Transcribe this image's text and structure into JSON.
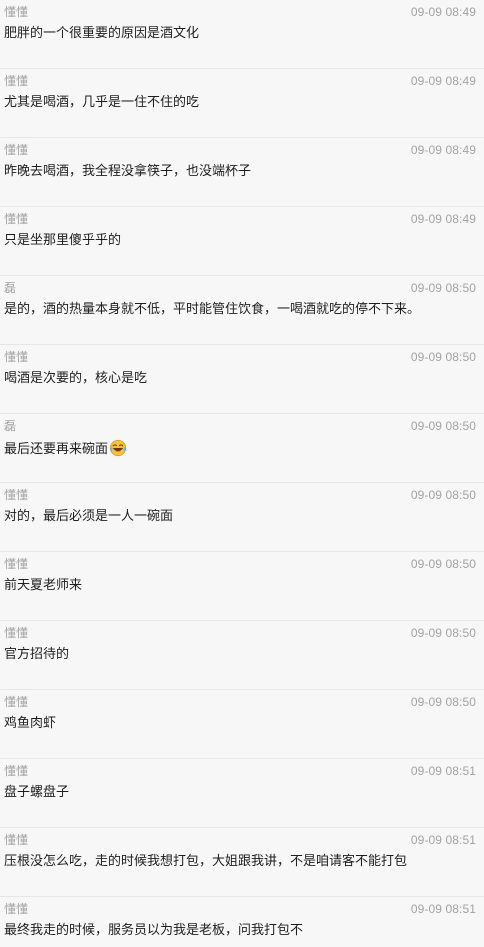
{
  "messages": [
    {
      "sender": "懂懂",
      "time": "09-09 08:49",
      "text": "肥胖的一个很重要的原因是酒文化"
    },
    {
      "sender": "懂懂",
      "time": "09-09 08:49",
      "text": "尤其是喝酒，几乎是一住不住的吃"
    },
    {
      "sender": "懂懂",
      "time": "09-09 08:49",
      "text": "昨晚去喝酒，我全程没拿筷子，也没端杯子"
    },
    {
      "sender": "懂懂",
      "time": "09-09 08:49",
      "text": "只是坐那里傻乎乎的"
    },
    {
      "sender": "磊",
      "time": "09-09 08:50",
      "text": "是的，酒的热量本身就不低，平时能管住饮食，一喝酒就吃的停不下来。"
    },
    {
      "sender": "懂懂",
      "time": "09-09 08:50",
      "text": "喝酒是次要的，核心是吃"
    },
    {
      "sender": "磊",
      "time": "09-09 08:50",
      "text": "最后还要再来碗面",
      "emoji": "laughing-tears-emoji"
    },
    {
      "sender": "懂懂",
      "time": "09-09 08:50",
      "text": "对的，最后必须是一人一碗面"
    },
    {
      "sender": "懂懂",
      "time": "09-09 08:50",
      "text": "前天夏老师来"
    },
    {
      "sender": "懂懂",
      "time": "09-09 08:50",
      "text": "官方招待的"
    },
    {
      "sender": "懂懂",
      "time": "09-09 08:50",
      "text": "鸡鱼肉虾"
    },
    {
      "sender": "懂懂",
      "time": "09-09 08:51",
      "text": "盘子螺盘子"
    },
    {
      "sender": "懂懂",
      "time": "09-09 08:51",
      "text": "压根没怎么吃，走的时候我想打包，大姐跟我讲，不是咱请客不能打包"
    },
    {
      "sender": "懂懂",
      "time": "09-09 08:51",
      "text": "最终我走的时候，服务员以为我是老板，问我打包不"
    }
  ]
}
